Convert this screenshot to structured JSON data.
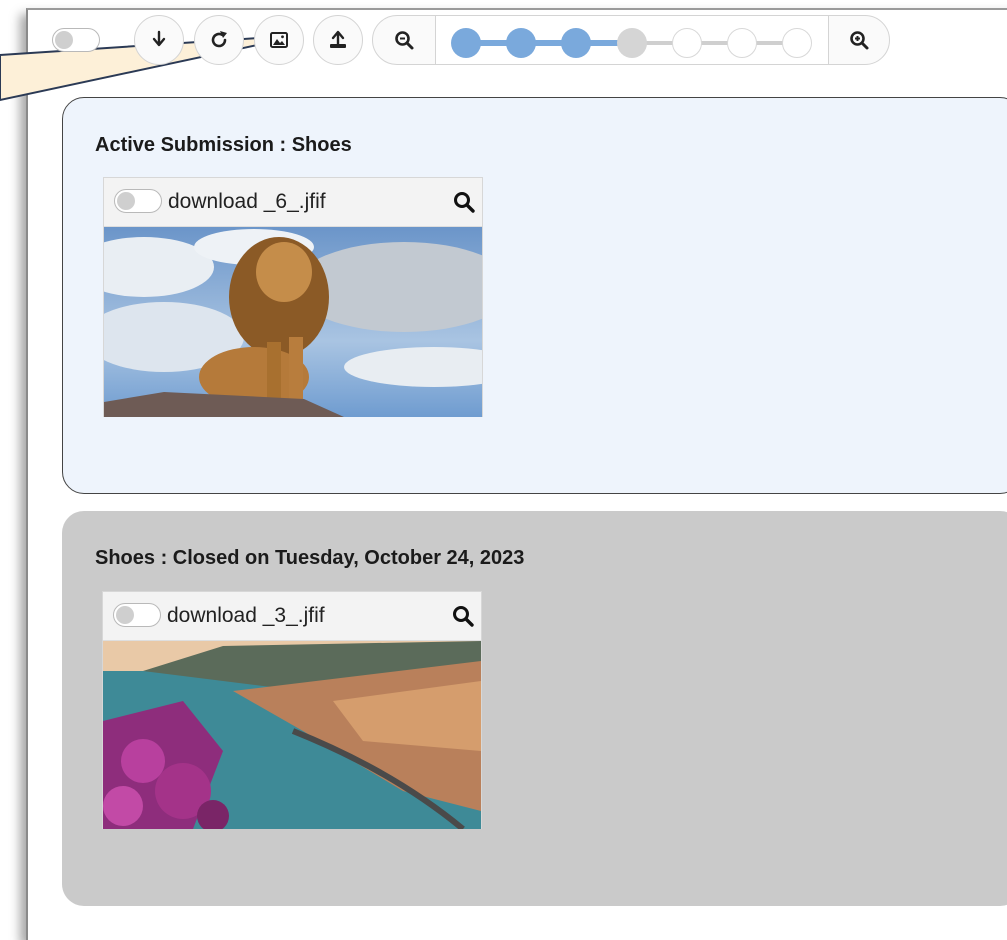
{
  "toolbar": {
    "buttons": [
      {
        "name": "download-button",
        "icon": "arrow-down-icon"
      },
      {
        "name": "refresh-button",
        "icon": "redo-icon"
      },
      {
        "name": "image-button",
        "icon": "image-icon"
      },
      {
        "name": "upload-button",
        "icon": "upload-icon"
      }
    ],
    "zoom": {
      "level": 4,
      "steps": 7
    }
  },
  "active_panel": {
    "title": "Active Submission : Shoes",
    "card": {
      "file_name": "download _6_.jfif",
      "image": "lion-photo"
    }
  },
  "closed_panel": {
    "title": "Shoes : Closed on Tuesday, October 24, 2023",
    "card": {
      "file_name": "download _3_.jfif",
      "image": "coastal-town-photo"
    }
  },
  "colors": {
    "accent": "#7aa9dc",
    "active_panel_bg": "#eef4fc",
    "closed_panel_bg": "#cacaca"
  }
}
